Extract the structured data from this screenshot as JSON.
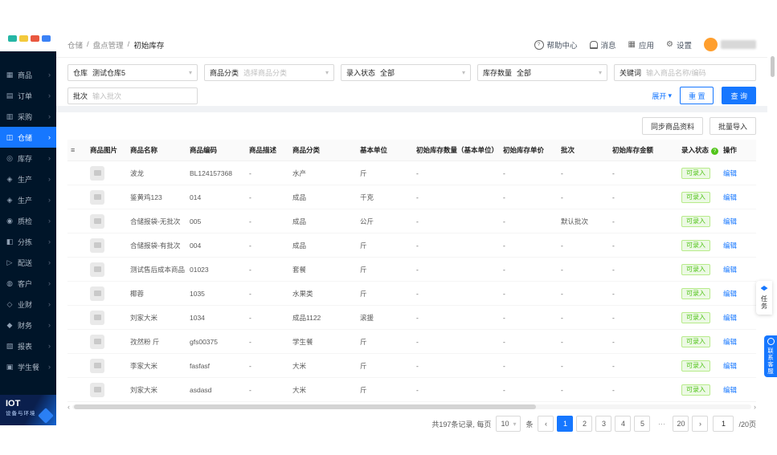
{
  "icons": {
    "chevron_down": "▾",
    "chevron_right": "›",
    "arrow_left": "‹",
    "arrow_right": "›",
    "help": "?",
    "apps": "▦",
    "gear": "⚙",
    "list": "≡",
    "info": "?"
  },
  "logo": {
    "colors": [
      "#26b6a5",
      "#f3c93c",
      "#e9573f",
      "#3b82f6"
    ]
  },
  "sidebar": {
    "items": [
      {
        "key": "product",
        "label": "商品",
        "glyph": "▦"
      },
      {
        "key": "order",
        "label": "订单",
        "glyph": "▤"
      },
      {
        "key": "purchase",
        "label": "采购",
        "glyph": "▥"
      },
      {
        "key": "warehouse",
        "label": "仓储",
        "glyph": "◫",
        "active": true
      },
      {
        "key": "inventory",
        "label": "库存",
        "glyph": "◎"
      },
      {
        "key": "production1",
        "label": "生产",
        "glyph": "◈"
      },
      {
        "key": "production2",
        "label": "生产",
        "glyph": "◈"
      },
      {
        "key": "quality",
        "label": "质检",
        "glyph": "◉"
      },
      {
        "key": "sorting",
        "label": "分拣",
        "glyph": "◧"
      },
      {
        "key": "delivery",
        "label": "配送",
        "glyph": "▷"
      },
      {
        "key": "customer",
        "label": "客户",
        "glyph": "◍"
      },
      {
        "key": "bizfinance",
        "label": "业财",
        "glyph": "◇"
      },
      {
        "key": "finance",
        "label": "财务",
        "glyph": "◆"
      },
      {
        "key": "report",
        "label": "报表",
        "glyph": "▧"
      },
      {
        "key": "studentmeal",
        "label": "学生餐",
        "glyph": "▣"
      }
    ]
  },
  "header": {
    "breadcrumb": [
      "仓储",
      "盘点管理",
      "初始库存"
    ],
    "separator": "/",
    "help": "帮助中心",
    "messages": "消息",
    "apps": "应用",
    "settings": "设置"
  },
  "filters": {
    "warehouse": {
      "label": "仓库",
      "value": "测试仓库5"
    },
    "category": {
      "label": "商品分类",
      "placeholder": "选择商品分类"
    },
    "entry_status": {
      "label": "录入状态",
      "value": "全部"
    },
    "stock_qty": {
      "label": "库存数量",
      "value": "全部"
    },
    "keyword": {
      "label": "关键词",
      "placeholder": "输入商品名称/编码"
    },
    "batch": {
      "label": "批次",
      "placeholder": "输入批次"
    },
    "expand": "展开",
    "reset": "重 置",
    "search": "查 询"
  },
  "toolbar": {
    "sync": "同步商品资料",
    "import": "批量导入"
  },
  "table": {
    "columns": [
      "商品图片",
      "商品名称",
      "商品编码",
      "商品描述",
      "商品分类",
      "基本单位",
      "初始库存数量（基本单位）",
      "初始库存单价",
      "批次",
      "初始库存金额",
      "录入状态",
      "操作"
    ],
    "rows": [
      {
        "name": "波龙",
        "code": "BL124157368",
        "desc": "-",
        "category": "水产",
        "unit": "斤",
        "qty": "-",
        "price": "-",
        "batch": "-",
        "amount": "-",
        "status": "可录入",
        "action": "编辑"
      },
      {
        "name": "鉴黄鸡123",
        "code": "014",
        "desc": "-",
        "category": "成品",
        "unit": "千克",
        "qty": "-",
        "price": "-",
        "batch": "-",
        "amount": "-",
        "status": "可录入",
        "action": "编辑"
      },
      {
        "name": "合储报袋-无批次",
        "code": "005",
        "desc": "-",
        "category": "成品",
        "unit": "公斤",
        "qty": "-",
        "price": "-",
        "batch": "默认批次",
        "amount": "-",
        "status": "可录入",
        "action": "编辑"
      },
      {
        "name": "合储报袋-有批次",
        "code": "004",
        "desc": "-",
        "category": "成品",
        "unit": "斤",
        "qty": "-",
        "price": "-",
        "batch": "-",
        "amount": "-",
        "status": "可录入",
        "action": "编辑"
      },
      {
        "name": "测试售后成本商品",
        "code": "01023",
        "desc": "-",
        "category": "套餐",
        "unit": "斤",
        "qty": "-",
        "price": "-",
        "batch": "-",
        "amount": "-",
        "status": "可录入",
        "action": "编辑"
      },
      {
        "name": "椰蓉",
        "code": "1035",
        "desc": "-",
        "category": "水果类",
        "unit": "斤",
        "qty": "-",
        "price": "-",
        "batch": "-",
        "amount": "-",
        "status": "可录入",
        "action": "编辑"
      },
      {
        "name": "刘家大米",
        "code": "1034",
        "desc": "-",
        "category": "成品1122",
        "unit": "滚援",
        "qty": "-",
        "price": "-",
        "batch": "-",
        "amount": "-",
        "status": "可录入",
        "action": "编辑"
      },
      {
        "name": "孜然粉 斤",
        "code": "gfs00375",
        "desc": "-",
        "category": "学生餐",
        "unit": "斤",
        "qty": "-",
        "price": "-",
        "batch": "-",
        "amount": "-",
        "status": "可录入",
        "action": "编辑"
      },
      {
        "name": "李家大米",
        "code": "fasfasf",
        "desc": "-",
        "category": "大米",
        "unit": "斤",
        "qty": "-",
        "price": "-",
        "batch": "-",
        "amount": "-",
        "status": "可录入",
        "action": "编辑"
      },
      {
        "name": "刘家大米",
        "code": "asdasd",
        "desc": "-",
        "category": "大米",
        "unit": "斤",
        "qty": "-",
        "price": "-",
        "batch": "-",
        "amount": "-",
        "status": "可录入",
        "action": "编辑"
      }
    ]
  },
  "pagination": {
    "total_text": "共197条记录, 每页",
    "page_size": "10",
    "unit_text": "条",
    "pages": [
      {
        "label": "1",
        "active": true
      },
      {
        "label": "2"
      },
      {
        "label": "3"
      },
      {
        "label": "4"
      },
      {
        "label": "5"
      },
      {
        "label": "···",
        "ellipsis": true
      },
      {
        "label": "20"
      }
    ],
    "jump_value": "1",
    "jump_suffix": "/20页"
  },
  "floating": {
    "tasks": "任务",
    "support": "联系客服"
  },
  "iot": {
    "title": "IOT",
    "subtitle": "设备与环境"
  }
}
